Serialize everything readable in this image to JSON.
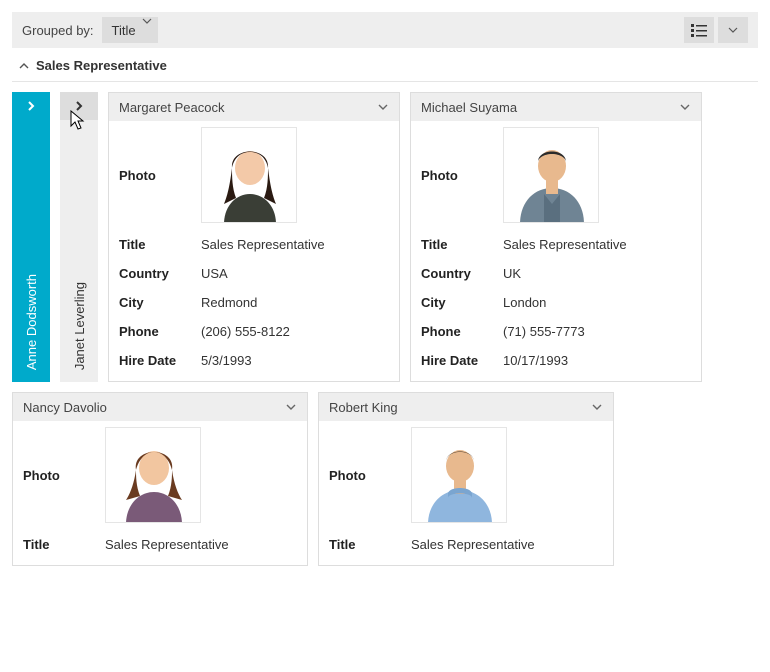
{
  "toolbar": {
    "label": "Grouped by:",
    "group_field": "Title"
  },
  "group": {
    "title": "Sales Representative"
  },
  "fields": {
    "photo": "Photo",
    "title": "Title",
    "country": "Country",
    "city": "City",
    "phone": "Phone",
    "hire": "Hire Date"
  },
  "collapsed": [
    {
      "name": "Anne Dodsworth",
      "active": true
    },
    {
      "name": "Janet Leverling",
      "active": false
    }
  ],
  "cards": [
    {
      "name": "Margaret Peacock",
      "title": "Sales Representative",
      "country": "USA",
      "city": "Redmond",
      "phone": "(206) 555-8122",
      "hire": "5/3/1993"
    },
    {
      "name": "Michael Suyama",
      "title": "Sales Representative",
      "country": "UK",
      "city": "London",
      "phone": "(71) 555-7773",
      "hire": "10/17/1993"
    }
  ],
  "cards_row2": [
    {
      "name": "Nancy Davolio",
      "title": "Sales Representative"
    },
    {
      "name": "Robert King",
      "title": "Sales Representative"
    }
  ]
}
